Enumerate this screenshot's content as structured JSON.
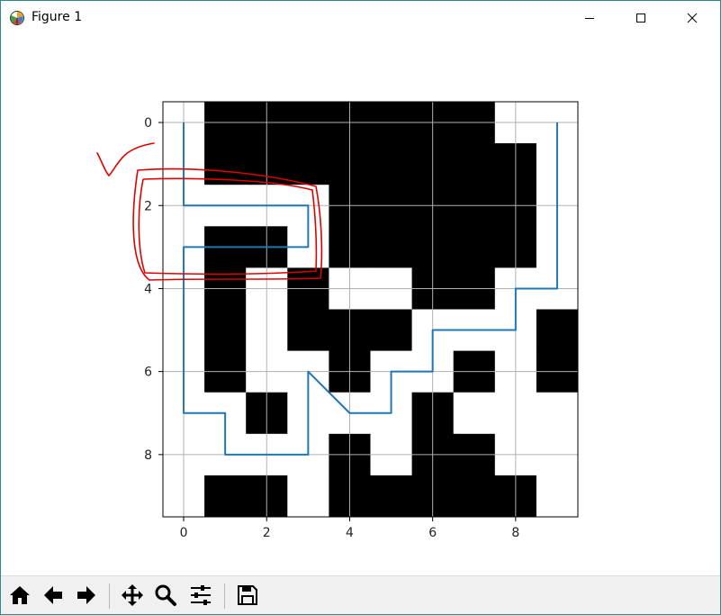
{
  "window": {
    "title": "Figure 1"
  },
  "icons": {
    "app": "matplotlib-figure-icon",
    "minimize": "minimize-icon",
    "maximize": "maximize-icon",
    "close": "close-icon"
  },
  "toolbar": {
    "buttons": [
      {
        "name": "home-button",
        "icon": "home-icon"
      },
      {
        "name": "back-button",
        "icon": "arrow-left-icon"
      },
      {
        "name": "forward-button",
        "icon": "arrow-right-icon"
      },
      {
        "name": "pan-button",
        "icon": "move-icon"
      },
      {
        "name": "zoom-button",
        "icon": "magnifier-icon"
      },
      {
        "name": "configure-subplots-button",
        "icon": "sliders-icon"
      },
      {
        "name": "save-button",
        "icon": "floppy-disk-icon"
      }
    ]
  },
  "chart_data": {
    "type": "heatmap",
    "colormap": "gray",
    "grid": true,
    "xlim": [
      -0.5,
      9.5
    ],
    "ylim": [
      9.5,
      -0.5
    ],
    "xticks": [
      "0",
      "2",
      "4",
      "6",
      "8"
    ],
    "yticks": [
      "0",
      "2",
      "4",
      "6",
      "8"
    ],
    "grid_values": [
      [
        0,
        1,
        1,
        1,
        1,
        1,
        1,
        1,
        0,
        0
      ],
      [
        0,
        1,
        1,
        1,
        1,
        1,
        1,
        1,
        1,
        0
      ],
      [
        0,
        0,
        0,
        0,
        1,
        1,
        1,
        1,
        1,
        0
      ],
      [
        0,
        1,
        1,
        0,
        1,
        1,
        1,
        1,
        1,
        0
      ],
      [
        0,
        1,
        0,
        1,
        0,
        0,
        1,
        1,
        0,
        0
      ],
      [
        0,
        1,
        0,
        1,
        1,
        1,
        0,
        0,
        0,
        1
      ],
      [
        0,
        1,
        0,
        0,
        1,
        0,
        0,
        1,
        0,
        1
      ],
      [
        0,
        0,
        1,
        0,
        0,
        0,
        1,
        0,
        0,
        0
      ],
      [
        0,
        0,
        0,
        0,
        1,
        0,
        1,
        1,
        0,
        0
      ],
      [
        0,
        1,
        1,
        0,
        1,
        1,
        1,
        1,
        1,
        0
      ]
    ],
    "series": [
      {
        "color": "#1f77b4",
        "x": [
          0,
          0,
          3,
          3,
          0,
          0,
          1,
          1,
          3,
          3,
          4,
          5,
          5,
          6,
          6,
          8,
          8,
          9,
          9
        ],
        "y": [
          0,
          2,
          2,
          3,
          3,
          7,
          7,
          8,
          8,
          6,
          7,
          7,
          6,
          6,
          5,
          5,
          4,
          4,
          0
        ]
      }
    ],
    "annotations": [
      {
        "kind": "freehand-checkmark",
        "color": "#e00000"
      },
      {
        "kind": "freehand-rectangle-outline",
        "color": "#e00000"
      }
    ]
  }
}
